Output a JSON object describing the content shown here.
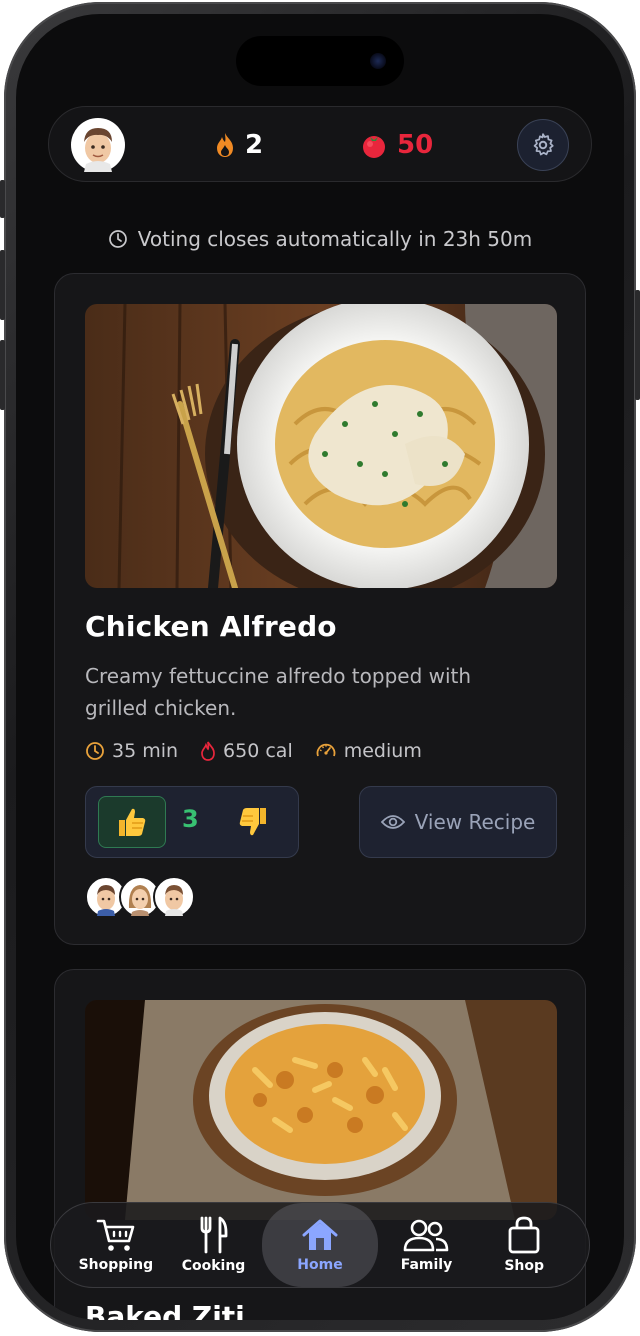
{
  "header": {
    "streak_count": "2",
    "tomato_count": "50"
  },
  "voting_notice": "Voting closes automatically in 23h 50m",
  "recipes": [
    {
      "title": "Chicken Alfredo",
      "description": "Creamy fettuccine alfredo topped with grilled chicken.",
      "time": "35 min",
      "calories": "650 cal",
      "difficulty": "medium",
      "votes": "3",
      "view_label": "View Recipe",
      "image_icon": "chicken-alfredo-photo"
    },
    {
      "title": "Baked Ziti",
      "image_icon": "baked-ziti-photo"
    }
  ],
  "nav": {
    "items": [
      {
        "label": "Shopping",
        "icon": "cart-icon"
      },
      {
        "label": "Cooking",
        "icon": "utensils-icon"
      },
      {
        "label": "Home",
        "icon": "home-icon"
      },
      {
        "label": "Family",
        "icon": "family-icon"
      },
      {
        "label": "Shop",
        "icon": "bag-icon"
      }
    ],
    "active": "Home"
  },
  "colors": {
    "accent": "#8ba6ff",
    "tomato": "#e8263c",
    "vote_green": "#38c172",
    "flame": "#f08a24"
  }
}
